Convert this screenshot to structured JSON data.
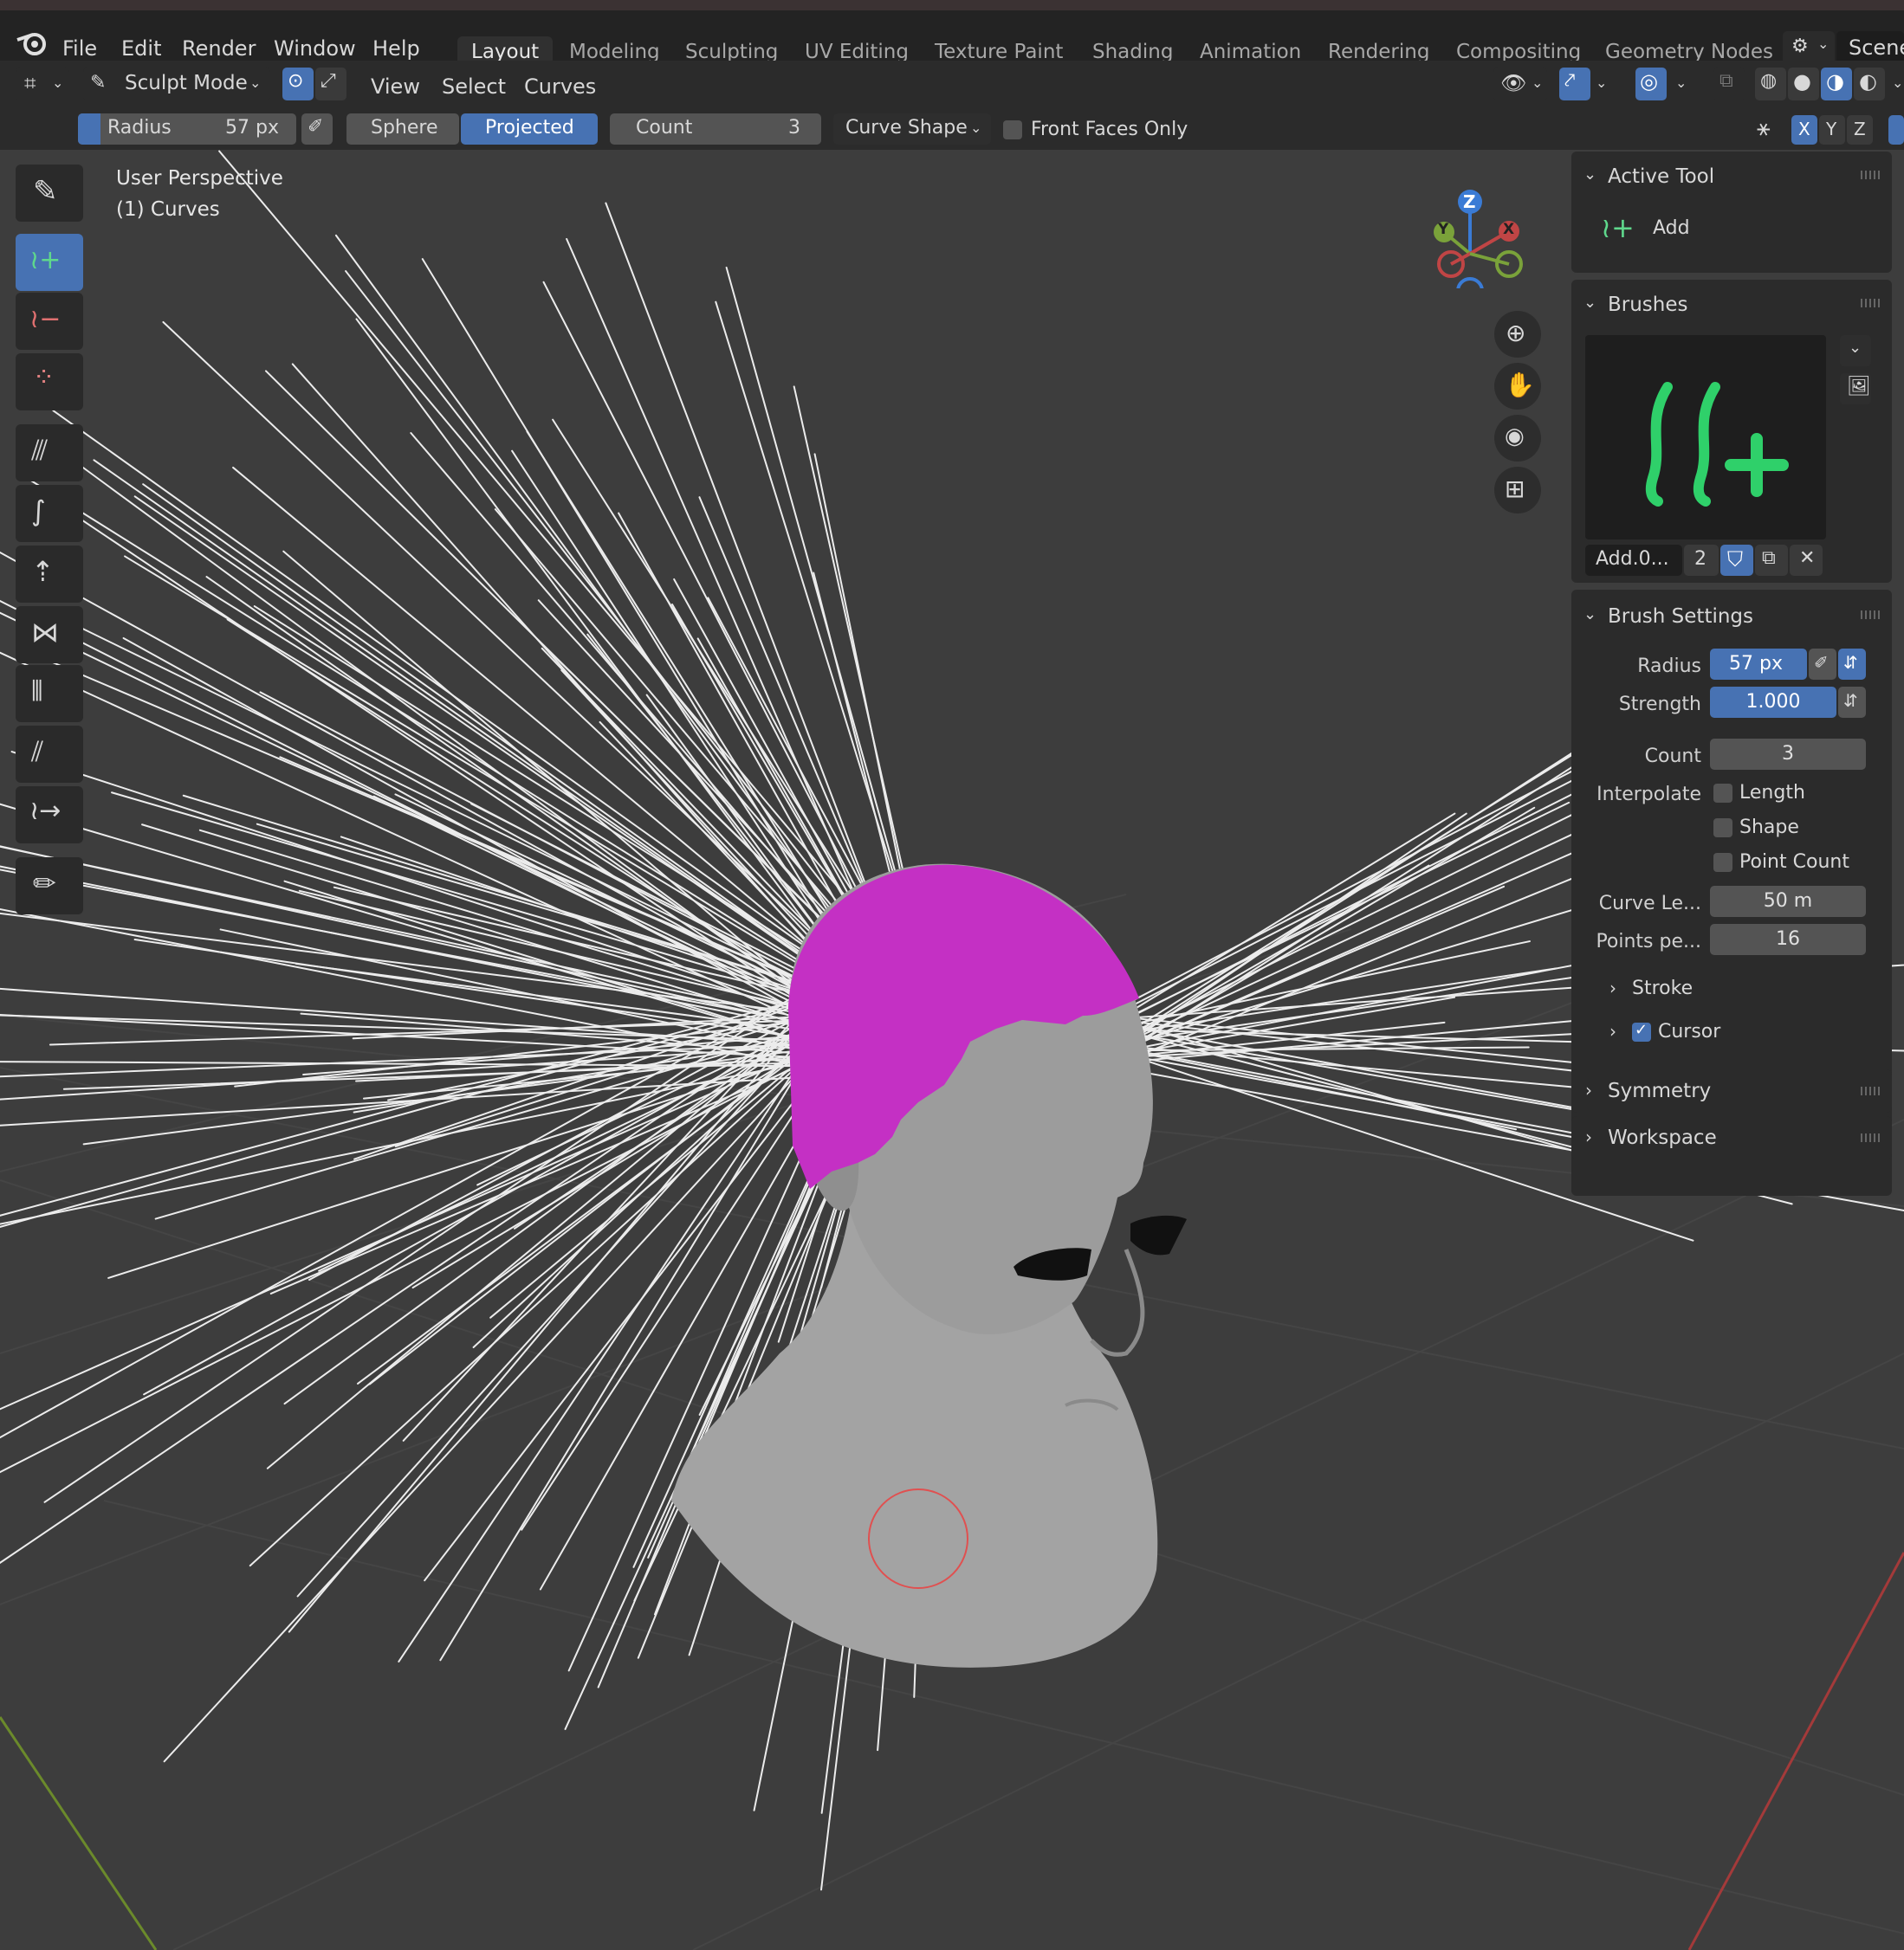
{
  "topbar": {
    "menus": [
      "File",
      "Edit",
      "Render",
      "Window",
      "Help"
    ],
    "workspaces": [
      "Layout",
      "Modeling",
      "Sculpting",
      "UV Editing",
      "Texture Paint",
      "Shading",
      "Animation",
      "Rendering",
      "Compositing",
      "Geometry Nodes"
    ],
    "active_workspace": "Layout",
    "scene_label": "Scene"
  },
  "header": {
    "mode": "Sculpt Mode",
    "menus": [
      "View",
      "Select",
      "Curves"
    ]
  },
  "tool_settings": {
    "radius_label": "Radius",
    "radius_value": "57 px",
    "falloff_sphere": "Sphere",
    "falloff_projected": "Projected",
    "count_label": "Count",
    "count_value": "3",
    "curve_shape": "Curve Shape",
    "front_faces_only": "Front Faces Only",
    "axes": [
      "X",
      "Y",
      "Z"
    ]
  },
  "viewport": {
    "view_name": "User Perspective",
    "object_name": "(1) Curves",
    "gizmo_axes": {
      "z": "Z",
      "y": "Y",
      "x": "X"
    },
    "colors": {
      "scalp": "#c430c4",
      "skin": "#9a9a9a",
      "hair": "#ececec",
      "x_axis": "#b03a3a",
      "y_axis": "#7aa23a"
    }
  },
  "tools": [
    "draw-tool",
    "add-curves",
    "delete-curves",
    "density",
    "comb",
    "snake-hook",
    "grow-shrink",
    "pinch",
    "puff",
    "smooth",
    "slide",
    "annotate"
  ],
  "sidepanel": {
    "active_tool": {
      "title": "Active Tool",
      "tool_name": "Add"
    },
    "brushes": {
      "title": "Brushes",
      "brush_name": "Add.0...",
      "users": "2"
    },
    "brush_settings": {
      "title": "Brush Settings",
      "radius_label": "Radius",
      "radius_value": "57 px",
      "strength_label": "Strength",
      "strength_value": "1.000",
      "count_label": "Count",
      "count_value": "3",
      "interpolate_label": "Interpolate",
      "length": "Length",
      "shape": "Shape",
      "point_count": "Point Count",
      "curve_length_label": "Curve Le...",
      "curve_length_value": "50 m",
      "points_label": "Points pe...",
      "points_value": "16",
      "stroke": "Stroke",
      "cursor": "Cursor"
    },
    "symmetry": "Symmetry",
    "workspace": "Workspace"
  }
}
